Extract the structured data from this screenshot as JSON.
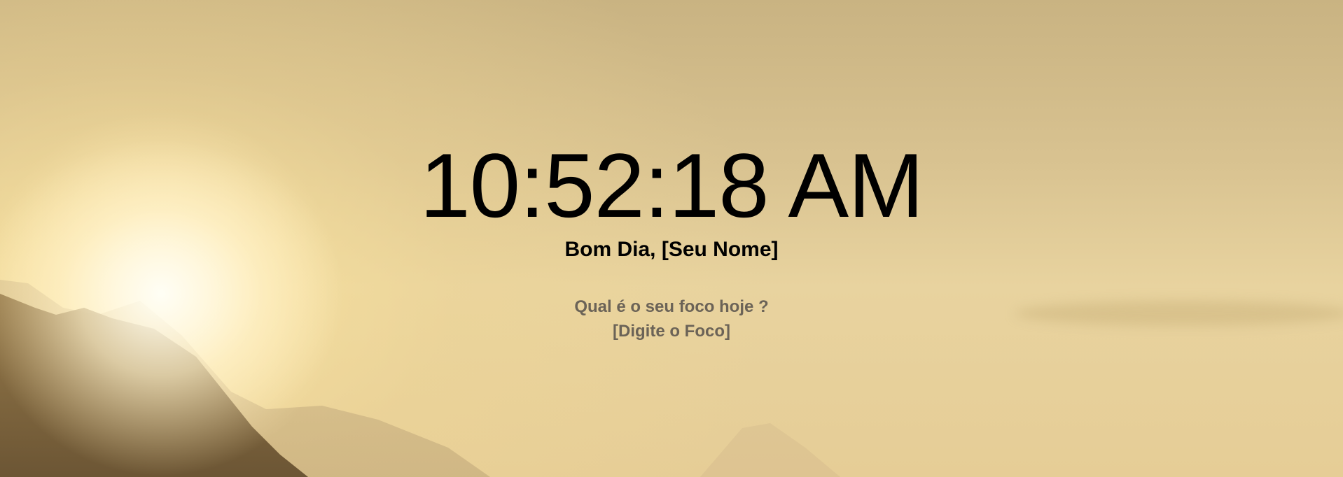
{
  "clock": {
    "time": "10:52:18 AM"
  },
  "greeting": {
    "prefix": "Bom Dia, ",
    "name": "[Seu Nome]"
  },
  "focus": {
    "question": "Qual é o seu foco hoje ?",
    "value": "[Digite o Foco]"
  }
}
